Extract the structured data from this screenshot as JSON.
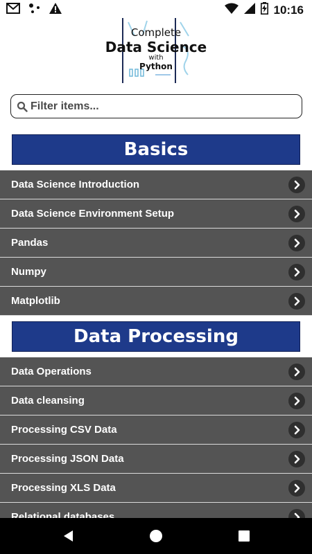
{
  "status_bar": {
    "time": "10:16",
    "left_icons": [
      "gmail-icon",
      "dots-icon",
      "warning-icon"
    ],
    "right_icons": [
      "wifi-icon",
      "signal-icon",
      "battery-charging-icon"
    ]
  },
  "logo": {
    "line1": "Complete",
    "line2": "Data Science",
    "line3": "with",
    "line4": "Python"
  },
  "search": {
    "placeholder": "Filter items...",
    "value": ""
  },
  "sections": [
    {
      "title": "Basics",
      "items": [
        {
          "label": "Data Science Introduction"
        },
        {
          "label": "Data Science Environment Setup"
        },
        {
          "label": "Pandas"
        },
        {
          "label": "Numpy"
        },
        {
          "label": "Matplotlib"
        }
      ]
    },
    {
      "title": "Data Processing",
      "items": [
        {
          "label": "Data Operations"
        },
        {
          "label": "Data cleansing"
        },
        {
          "label": "Processing CSV Data"
        },
        {
          "label": "Processing JSON Data"
        },
        {
          "label": "Processing XLS Data"
        },
        {
          "label": "Relational databases"
        }
      ]
    }
  ],
  "nav_bar": {
    "icons": [
      "back-icon",
      "home-icon",
      "recents-icon"
    ]
  },
  "colors": {
    "section_header": "#1e3a8a",
    "row_bg": "#545454",
    "chevron_bg": "#2f2f2f"
  }
}
